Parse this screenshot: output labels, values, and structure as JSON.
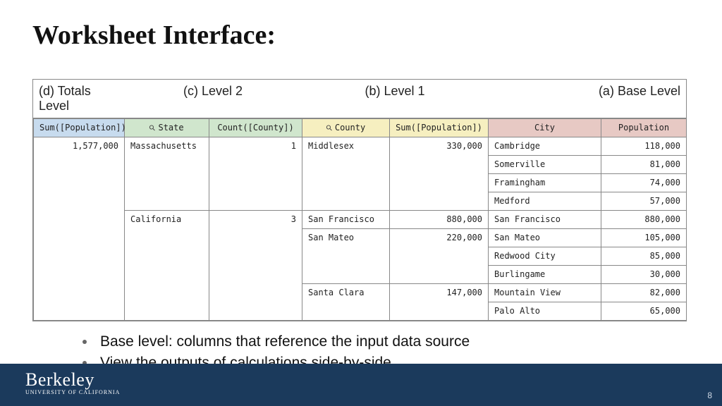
{
  "title": "Worksheet Interface:",
  "levels": {
    "d": "(d) Totals Level",
    "c": "(c) Level 2",
    "b": "(b) Level 1",
    "a": "(a) Base Level"
  },
  "headers": {
    "sum_pop_d": "Sum([Population])",
    "state": "State",
    "count_county": "Count([County])",
    "county": "County",
    "sum_pop_b": "Sum([Population])",
    "city": "City",
    "population": "Population"
  },
  "totals": {
    "sum_pop": "1,577,000"
  },
  "states": [
    {
      "state": "Massachusetts",
      "count_county": "1",
      "counties": [
        {
          "county": "Middlesex",
          "sum_pop": "330,000",
          "cities": [
            {
              "city": "Cambridge",
              "pop": "118,000"
            },
            {
              "city": "Somerville",
              "pop": "81,000"
            },
            {
              "city": "Framingham",
              "pop": "74,000"
            },
            {
              "city": "Medford",
              "pop": "57,000"
            }
          ]
        }
      ]
    },
    {
      "state": "California",
      "count_county": "3",
      "counties": [
        {
          "county": "San Francisco",
          "sum_pop": "880,000",
          "cities": [
            {
              "city": "San Francisco",
              "pop": "880,000"
            }
          ]
        },
        {
          "county": "San Mateo",
          "sum_pop": "220,000",
          "cities": [
            {
              "city": "San Mateo",
              "pop": "105,000"
            },
            {
              "city": "Redwood City",
              "pop": "85,000"
            },
            {
              "city": "Burlingame",
              "pop": "30,000"
            }
          ]
        },
        {
          "county": "Santa Clara",
          "sum_pop": "147,000",
          "cities": [
            {
              "city": "Mountain View",
              "pop": "82,000"
            },
            {
              "city": "Palo Alto",
              "pop": "65,000"
            }
          ]
        }
      ]
    }
  ],
  "bullets": [
    "Base level: columns that reference the input data source",
    "View the outputs of calculations side-by-side"
  ],
  "footer": {
    "logo_top": "Berkeley",
    "logo_sub": "UNIVERSITY OF CALIFORNIA",
    "page": "8"
  }
}
